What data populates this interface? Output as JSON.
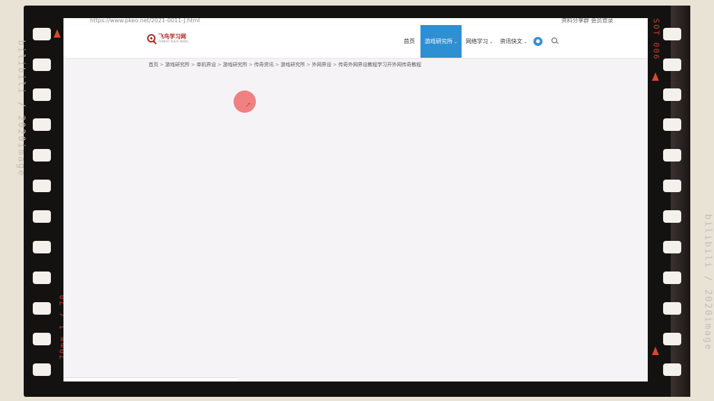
{
  "film": {
    "left_text": "bilibili / 2020image",
    "right_text": "bilibili / 2020image",
    "left_red_text": "70mm  1 / 70",
    "right_red_text": "SOT  006"
  },
  "browser": {
    "url": "https://www.pkeo.net/2021-0011-J.html",
    "right_text": "资料分享群 会员登录"
  },
  "site": {
    "logo_name": "飞鸟学习网",
    "logo_sub": "FEINIAO XUEXI WANG",
    "nav": [
      {
        "label": "首页",
        "active": false,
        "dropdown": false
      },
      {
        "label": "游戏研究所",
        "active": true,
        "dropdown": true
      },
      {
        "label": "网络学习",
        "active": false,
        "dropdown": true
      },
      {
        "label": "资讯快文",
        "active": false,
        "dropdown": true
      }
    ],
    "breadcrumb": [
      "首页",
      "游戏研究所",
      "单机界设",
      "游戏研究所",
      "传奇资讯",
      "游戏研究所",
      "外网界设",
      "传奇外网界设教程学习开外网传奇教程"
    ]
  },
  "colors": {
    "accent": "#2f8fd3",
    "cursor_highlight": "#f08081",
    "page_bg": "#f6f3f6"
  }
}
